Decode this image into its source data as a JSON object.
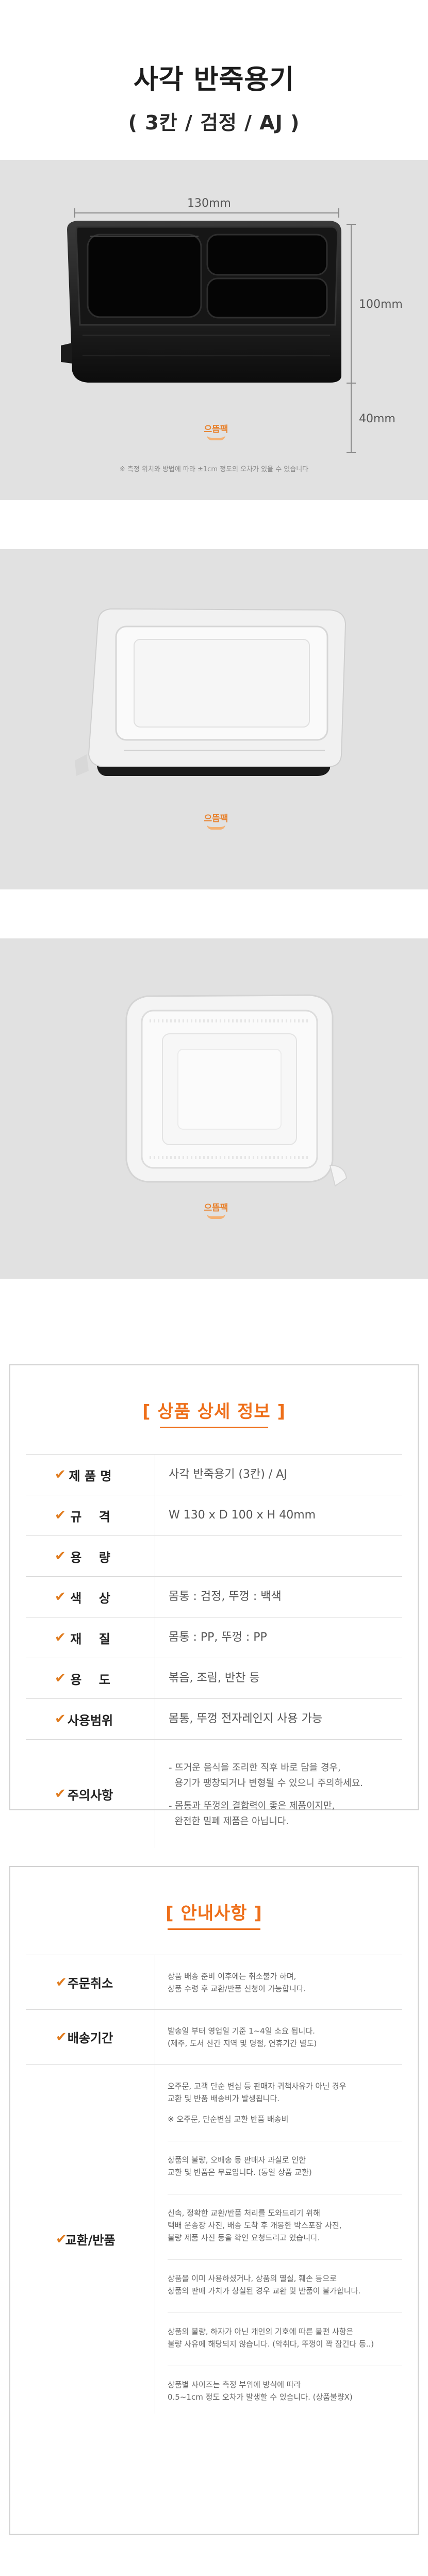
{
  "header": {
    "title": "사각 반죽용기",
    "subtitle": "( 3칸 / 검정 / AJ )"
  },
  "photo1": {
    "dim_width": "130mm",
    "dim_depth": "100mm",
    "dim_height": "40mm",
    "note": "※ 측정 위치와 방법에 따라 ±1cm 정도의 오차가 있을 수 있습니다",
    "brand": "으뜸팩"
  },
  "photo2": {
    "brand": "으뜸팩"
  },
  "photo3": {
    "brand": "으뜸팩"
  },
  "spec": {
    "title": "[ 상품 상세 정보 ]",
    "rows": [
      {
        "label": "제 품 명",
        "value": "사각 반죽용기 (3칸) / AJ"
      },
      {
        "label": "규    격",
        "value": "W 130 x D 100 x H 40mm"
      },
      {
        "label": "용    량",
        "value": ""
      },
      {
        "label": "색    상",
        "value": "몸통 : 검정,  뚜껑 : 백색"
      },
      {
        "label": "재    질",
        "value": "몸통 : PP,  뚜껑 : PP"
      },
      {
        "label": "용    도",
        "value": "볶음, 조림, 반찬 등"
      },
      {
        "label": "사용범위",
        "value": "몸통, 뚜껑 전자레인지 사용 가능"
      }
    ],
    "caution_label": "주의사항",
    "caution_lines": [
      "- 뜨거운 음식을 조리한 직후 바로 담을 경우,",
      "  용기가 팽창되거나 변형될 수 있으니 주의하세요.",
      "- 몸통과 뚜껑의 결합력이 좋은 제품이지만,",
      "  완전한 밀폐 제품은 아닙니다."
    ]
  },
  "guide": {
    "title": "[ 안내사항 ]",
    "order_cancel": {
      "label": "주문취소",
      "lines": [
        "상품 배송 준비 이후에는 취소불가 하며,",
        "상품 수령 후 교환/반품 신청이 가능합니다."
      ]
    },
    "delivery": {
      "label": "배송기간",
      "lines": [
        "발송일 부터 영업일 기준 1~4일 소요 됩니다.",
        "(제주, 도서 산간 지역 및 명절, 연휴기간 별도)"
      ]
    },
    "exchange": {
      "label": "교환/반품",
      "blocks": [
        [
          "오주문, 고객 단순 변심 등 판매자 귀책사유가 아닌 경우",
          "교환 및 반품 배송비가 발생됩니다.",
          "",
          "※ 오주문, 단순변심 교환 반품 배송비"
        ],
        [
          "상품의 불량, 오배송 등 판매자 과실로 인한",
          "교환 및 반품은 무료입니다. (동일 상품 교환)"
        ],
        [
          "신속, 정확한 교환/반품 처리를 도와드리기 위해",
          "택배 운송장 사진, 배송 도착 후 개봉한 박스포장 사진,",
          "불량 제품 사진 등을 확인 요청드리고 있습니다."
        ],
        [
          "상품을 이미 사용하셨거나, 상품의 멸실, 훼손 등으로",
          "상품의 판매 가치가 상실된 경우 교환 및 반품이 불가합니다."
        ],
        [
          "상품의 불량, 하자가 아닌 개인의 기호에 따른 불편 사항은",
          "불량 사유에 해당되지 않습니다. (악취다, 뚜껑이 꽉 잠긴다 등..)"
        ],
        [
          "상품별 사이즈는 측정 부위에 방식에 따라",
          "0.5~1cm 정도 오차가 발생할 수 있습니다. (상품불량X)"
        ]
      ]
    }
  },
  "colors": {
    "accent": "#ee6f1a",
    "check": "#e07a1c",
    "photo_bg": "#e1e1e1",
    "border": "#d2d2d2"
  },
  "icons": {
    "check": "✔"
  }
}
